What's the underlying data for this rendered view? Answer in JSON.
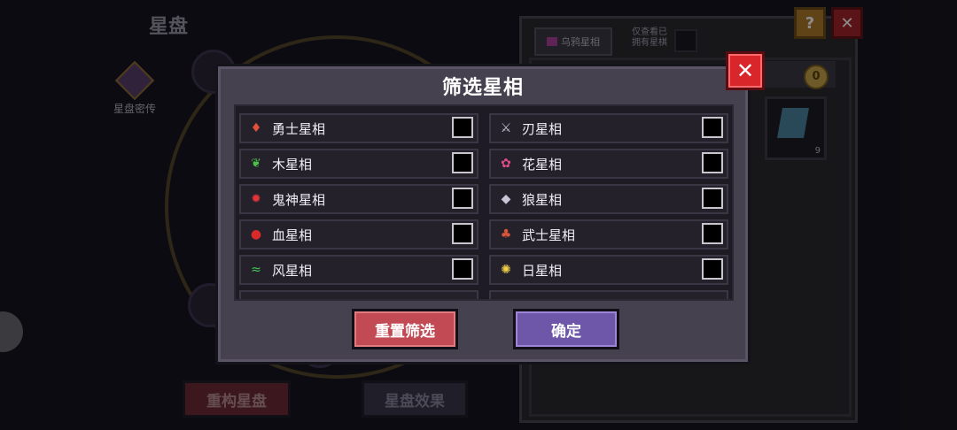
{
  "background": {
    "title": "星盘",
    "secret_label": "星盘密传",
    "rebuild_button": "重构星盘",
    "effect_button": "星盘效果",
    "help_icon": "?",
    "close_icon": "✕"
  },
  "right_panel": {
    "tab_label": "乌鸦星相",
    "only_owned_label": "仅查看已\n拥有星棋",
    "coin_symbol": "0",
    "item_count": "9"
  },
  "modal": {
    "title": "筛选星相",
    "close_symbol": "✕",
    "reset_button": "重置筛选",
    "confirm_button": "确定",
    "options_left": [
      {
        "label": "勇士星相",
        "icon": "warrior-icon",
        "color": "#e0503a",
        "checked": false
      },
      {
        "label": "木星相",
        "icon": "leaf-icon",
        "color": "#4cc04a",
        "checked": false
      },
      {
        "label": "鬼神星相",
        "icon": "demon-icon",
        "color": "#e0343a",
        "checked": false
      },
      {
        "label": "血星相",
        "icon": "blood-drop-icon",
        "color": "#d82a2a",
        "checked": false
      },
      {
        "label": "风星相",
        "icon": "wind-icon",
        "color": "#46c85a",
        "checked": false
      }
    ],
    "options_right": [
      {
        "label": "刃星相",
        "icon": "blade-icon",
        "color": "#c8c6d4",
        "checked": false
      },
      {
        "label": "花星相",
        "icon": "flower-icon",
        "color": "#e04c8a",
        "checked": false
      },
      {
        "label": "狼星相",
        "icon": "wolf-icon",
        "color": "#c8c6d4",
        "checked": false
      },
      {
        "label": "武士星相",
        "icon": "samurai-icon",
        "color": "#d8543a",
        "checked": false
      },
      {
        "label": "日星相",
        "icon": "sun-icon",
        "color": "#f0d04a",
        "checked": false
      }
    ]
  }
}
